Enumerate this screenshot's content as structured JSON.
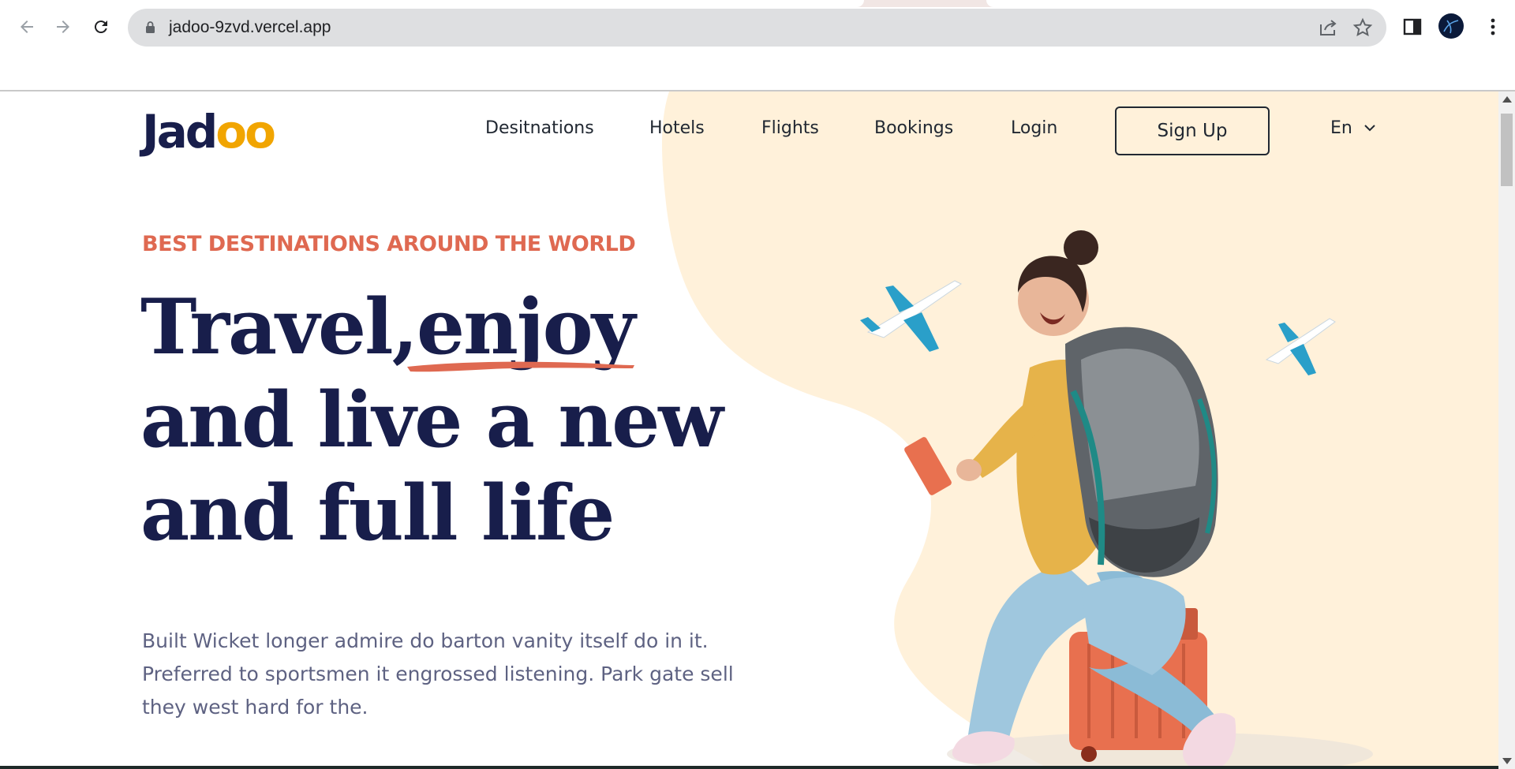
{
  "browser": {
    "url": "jadoo-9zvd.vercel.app",
    "icons": [
      "back-icon",
      "forward-icon",
      "reload-icon",
      "lock-icon",
      "share-icon",
      "star-icon",
      "side-panel-icon",
      "profile-avatar",
      "menu-kebab-icon"
    ]
  },
  "site": {
    "logo": {
      "prefix": "Jad",
      "suffix": "oo"
    },
    "nav": [
      "Desitnations",
      "Hotels",
      "Flights",
      "Bookings",
      "Login"
    ],
    "signup_label": "Sign Up",
    "language": "En"
  },
  "hero": {
    "eyebrow": "BEST DESTINATIONS AROUND THE WORLD",
    "title_line1": "Travel,enjoy",
    "title_line2": "and live a new",
    "title_line3": "and full life",
    "description": "Built Wicket longer admire do barton vanity itself do in it. Preferred to sportsmen it engrossed listening. Park gate sell they west hard for the."
  },
  "colors": {
    "navy": "#181e4b",
    "accent": "#df6951",
    "logo_accent": "#f1a501",
    "blob": "#fff1da",
    "text_muted": "#5e6282"
  }
}
